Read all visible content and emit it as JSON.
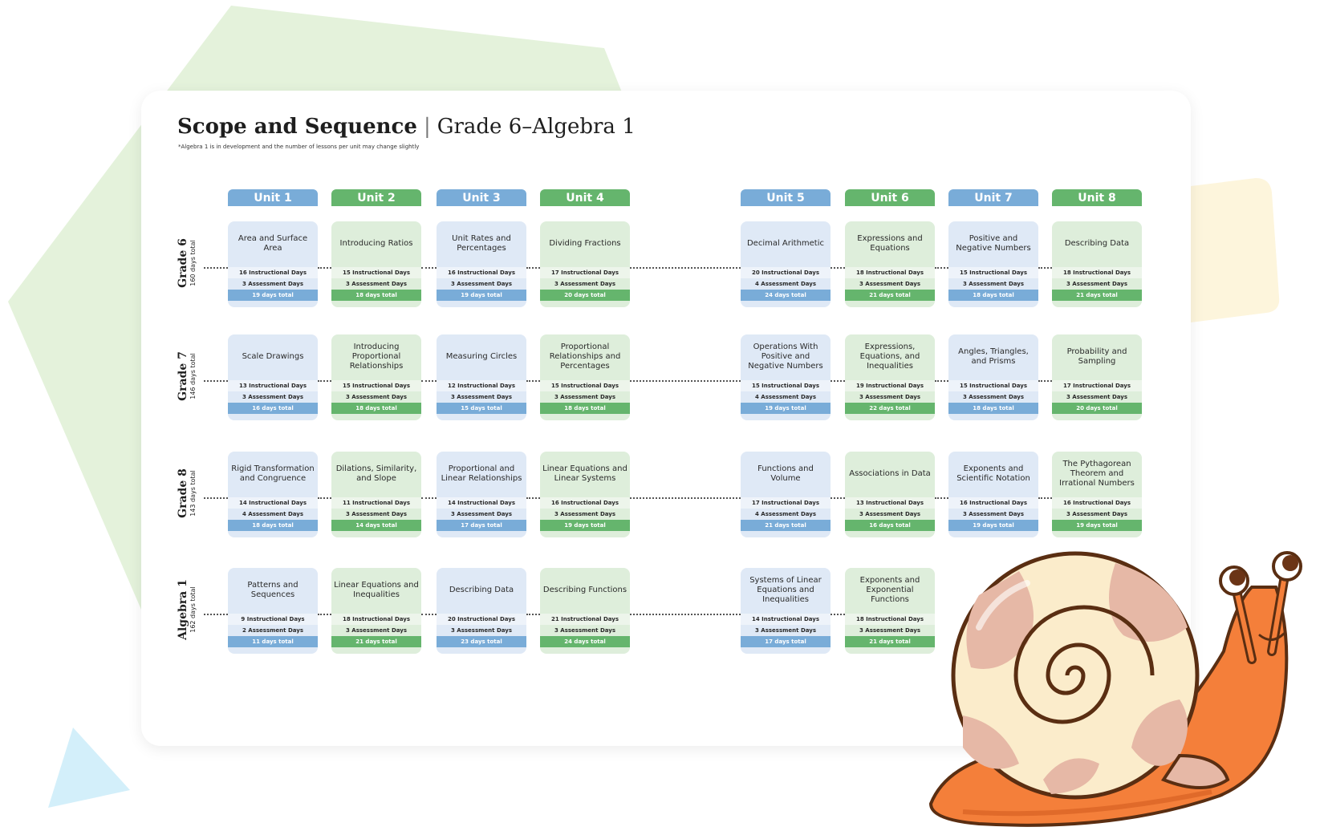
{
  "header": {
    "title": "Scope and Sequence",
    "separator": "|",
    "subtitle": "Grade 6–Algebra 1",
    "note": "*Algebra 1 is in development and the number of lessons per unit may change slightly"
  },
  "colors": {
    "blue": "#79acd8",
    "green": "#65b56d",
    "blue_light": "#dfe9f6",
    "green_light": "#deeedb",
    "bg_green": "#e4f2db",
    "bg_yellow": "#fdf5dc",
    "bg_triangle": "#d3effa",
    "snail_body": "#f47f3a"
  },
  "units": [
    "Unit 1",
    "Unit 2",
    "Unit 3",
    "Unit 4",
    "Unit 5",
    "Unit 6",
    "Unit 7",
    "Unit 8"
  ],
  "grades": [
    {
      "name": "Grade 6",
      "total": "160 days total",
      "units": [
        {
          "title": "Area and Surface Area",
          "instructional": "16 Instructional Days",
          "assessment": "3 Assessment Days",
          "total": "19 days total"
        },
        {
          "title": "Introducing Ratios",
          "instructional": "15 Instructional Days",
          "assessment": "3 Assessment Days",
          "total": "18 days total"
        },
        {
          "title": "Unit Rates and Percentages",
          "instructional": "16 Instructional Days",
          "assessment": "3 Assessment Days",
          "total": "19 days total"
        },
        {
          "title": "Dividing Fractions",
          "instructional": "17 Instructional Days",
          "assessment": "3 Assessment Days",
          "total": "20 days total"
        },
        {
          "title": "Decimal Arithmetic",
          "instructional": "20 Instructional Days",
          "assessment": "4 Assessment Days",
          "total": "24 days total"
        },
        {
          "title": "Expressions and Equations",
          "instructional": "18 Instructional Days",
          "assessment": "3 Assessment Days",
          "total": "21 days total"
        },
        {
          "title": "Positive and Negative Numbers",
          "instructional": "15 Instructional Days",
          "assessment": "3 Assessment Days",
          "total": "18 days total"
        },
        {
          "title": "Describing Data",
          "instructional": "18 Instructional Days",
          "assessment": "3 Assessment Days",
          "total": "21 days total"
        }
      ]
    },
    {
      "name": "Grade 7",
      "total": "146 days total",
      "units": [
        {
          "title": "Scale Drawings",
          "instructional": "13 Instructional Days",
          "assessment": "3 Assessment Days",
          "total": "16 days total"
        },
        {
          "title": "Introducing Proportional Relationships",
          "instructional": "15 Instructional Days",
          "assessment": "3 Assessment Days",
          "total": "18 days total"
        },
        {
          "title": "Measuring Circles",
          "instructional": "12 Instructional Days",
          "assessment": "3 Assessment Days",
          "total": "15 days total"
        },
        {
          "title": "Proportional Relationships and Percentages",
          "instructional": "15 Instructional Days",
          "assessment": "3 Assessment Days",
          "total": "18 days total"
        },
        {
          "title": "Operations With Positive and Negative Numbers",
          "instructional": "15 Instructional Days",
          "assessment": "4 Assessment Days",
          "total": "19 days total"
        },
        {
          "title": "Expressions, Equations, and Inequalities",
          "instructional": "19 Instructional Days",
          "assessment": "3 Assessment Days",
          "total": "22 days total"
        },
        {
          "title": "Angles, Triangles, and Prisms",
          "instructional": "15 Instructional Days",
          "assessment": "3 Assessment Days",
          "total": "18 days total"
        },
        {
          "title": "Probability and Sampling",
          "instructional": "17 Instructional Days",
          "assessment": "3 Assessment Days",
          "total": "20 days total"
        }
      ]
    },
    {
      "name": "Grade 8",
      "total": "143 days total",
      "units": [
        {
          "title": "Rigid Transformation and Congruence",
          "instructional": "14 Instructional Days",
          "assessment": "4 Assessment Days",
          "total": "18 days total"
        },
        {
          "title": "Dilations, Similarity, and Slope",
          "instructional": "11 Instructional Days",
          "assessment": "3 Assessment Days",
          "total": "14 days total"
        },
        {
          "title": "Proportional and Linear Relationships",
          "instructional": "14 Instructional Days",
          "assessment": "3 Assessment Days",
          "total": "17 days total"
        },
        {
          "title": "Linear Equations and Linear Systems",
          "instructional": "16 Instructional Days",
          "assessment": "3 Assessment Days",
          "total": "19 days total"
        },
        {
          "title": "Functions and Volume",
          "instructional": "17 Instructional Days",
          "assessment": "4 Assessment Days",
          "total": "21 days total"
        },
        {
          "title": "Associations in Data",
          "instructional": "13 Instructional Days",
          "assessment": "3 Assessment Days",
          "total": "16 days total"
        },
        {
          "title": "Exponents and Scientific Notation",
          "instructional": "16 Instructional Days",
          "assessment": "3 Assessment Days",
          "total": "19 days total"
        },
        {
          "title": "The Pythagorean Theorem and Irrational Numbers",
          "instructional": "16 Instructional Days",
          "assessment": "3 Assessment Days",
          "total": "19 days total"
        }
      ]
    },
    {
      "name": "Algebra 1",
      "total": "162 days total",
      "units": [
        {
          "title": "Patterns and Sequences",
          "instructional": "9 Instructional Days",
          "assessment": "2 Assessment Days",
          "total": "11 days total"
        },
        {
          "title": "Linear Equations and Inequalities",
          "instructional": "18 Instructional Days",
          "assessment": "3 Assessment Days",
          "total": "21 days total"
        },
        {
          "title": "Describing Data",
          "instructional": "20 Instructional Days",
          "assessment": "3 Assessment Days",
          "total": "23 days total"
        },
        {
          "title": "Describing Functions",
          "instructional": "21 Instructional Days",
          "assessment": "3 Assessment Days",
          "total": "24 days total"
        },
        {
          "title": "Systems of Linear Equations and Inequalities",
          "instructional": "14 Instructional Days",
          "assessment": "3 Assessment Days",
          "total": "17 days total"
        },
        {
          "title": "Exponents and Exponential Functions",
          "instructional": "18 Instructional Days",
          "assessment": "3 Assessment Days",
          "total": "21 days total"
        }
      ]
    }
  ]
}
